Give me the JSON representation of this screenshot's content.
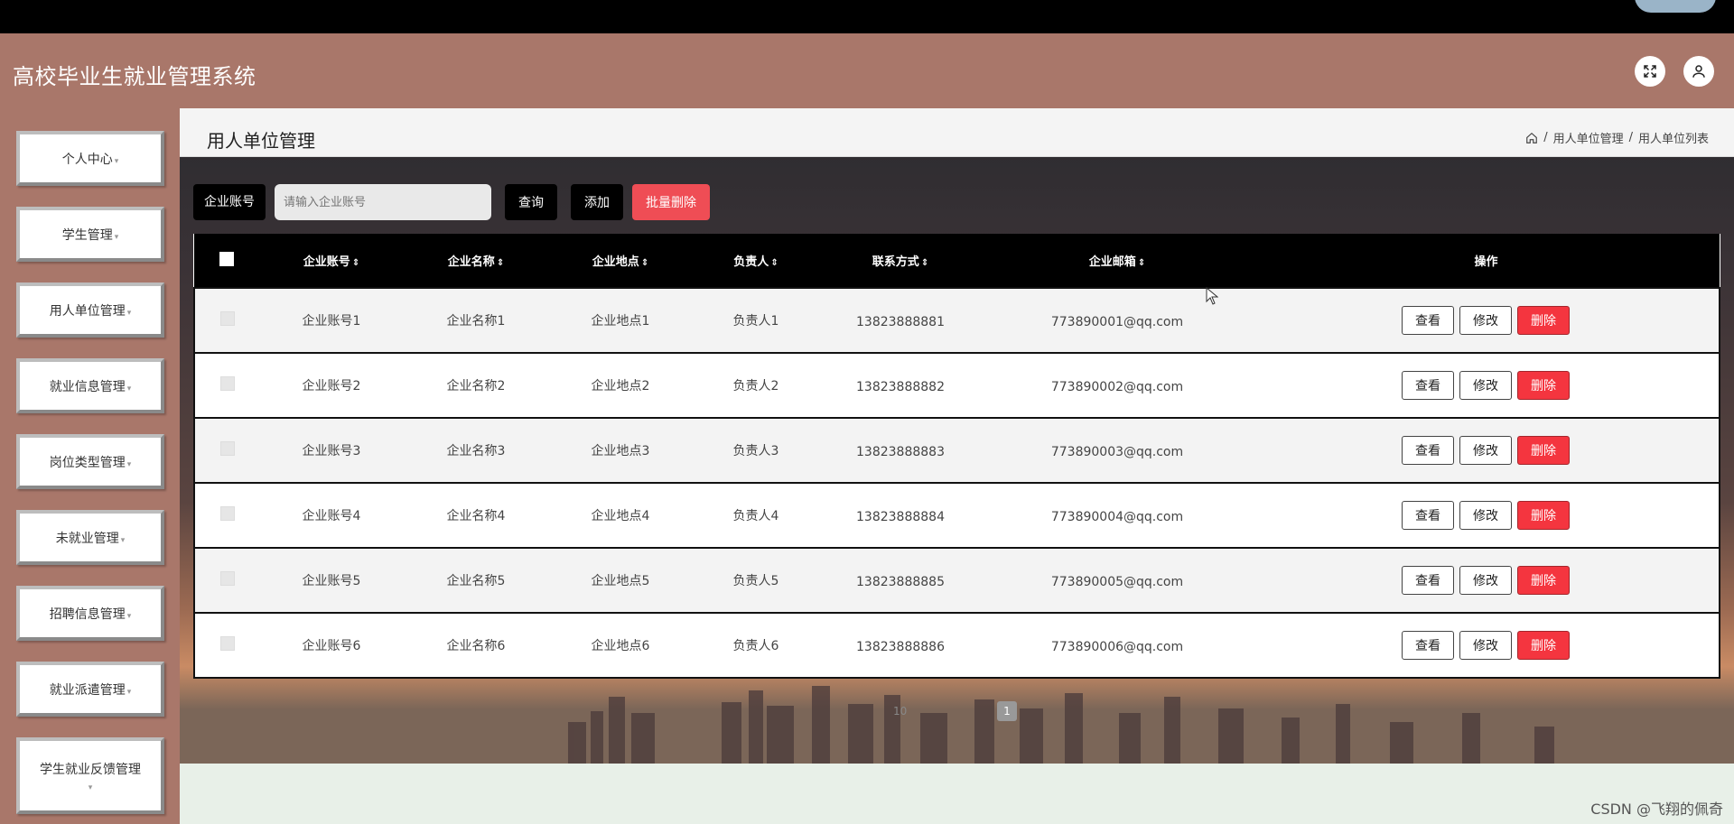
{
  "app": {
    "title": "高校毕业生就业管理系统"
  },
  "header_buttons": [
    {
      "icon": "fullscreen-icon"
    },
    {
      "icon": "user-icon"
    }
  ],
  "sidebar": {
    "items": [
      {
        "label": "个人中心"
      },
      {
        "label": "学生管理"
      },
      {
        "label": "用人单位管理"
      },
      {
        "label": "就业信息管理"
      },
      {
        "label": "岗位类型管理"
      },
      {
        "label": "未就业管理"
      },
      {
        "label": "招聘信息管理"
      },
      {
        "label": "就业派遣管理"
      },
      {
        "label": "学生就业反馈管理"
      }
    ]
  },
  "page": {
    "title": "用人单位管理",
    "breadcrumb": [
      "用人单位管理",
      "用人单位列表"
    ]
  },
  "search": {
    "label": "企业账号",
    "placeholder": "请输入企业账号",
    "query_label": "查询",
    "add_label": "添加",
    "batch_delete_label": "批量删除"
  },
  "table": {
    "headers": [
      "企业账号",
      "企业名称",
      "企业地点",
      "负责人",
      "联系方式",
      "企业邮箱",
      "操作"
    ],
    "action_labels": {
      "view": "查看",
      "edit": "修改",
      "delete": "删除"
    },
    "rows": [
      {
        "account": "企业账号1",
        "name": "企业名称1",
        "location": "企业地点1",
        "manager": "负责人1",
        "phone": "13823888881",
        "email": "773890001@qq.com"
      },
      {
        "account": "企业账号2",
        "name": "企业名称2",
        "location": "企业地点2",
        "manager": "负责人2",
        "phone": "13823888882",
        "email": "773890002@qq.com"
      },
      {
        "account": "企业账号3",
        "name": "企业名称3",
        "location": "企业地点3",
        "manager": "负责人3",
        "phone": "13823888883",
        "email": "773890003@qq.com"
      },
      {
        "account": "企业账号4",
        "name": "企业名称4",
        "location": "企业地点4",
        "manager": "负责人4",
        "phone": "13823888884",
        "email": "773890004@qq.com"
      },
      {
        "account": "企业账号5",
        "name": "企业名称5",
        "location": "企业地点5",
        "manager": "负责人5",
        "phone": "13823888885",
        "email": "773890005@qq.com"
      },
      {
        "account": "企业账号6",
        "name": "企业名称6",
        "location": "企业地点6",
        "manager": "负责人6",
        "phone": "13823888886",
        "email": "773890006@qq.com"
      }
    ]
  },
  "pagination": {
    "current_page": "1",
    "page_size": "10"
  },
  "watermark": "CSDN @飞翔的佩奇"
}
